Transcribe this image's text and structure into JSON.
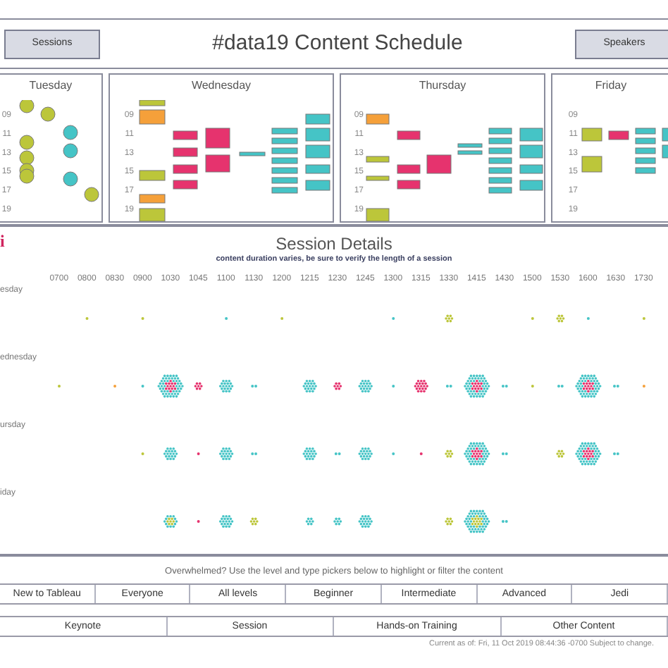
{
  "header": {
    "left_button": "Sessions",
    "title": "#data19 Content Schedule",
    "right_button": "Speakers"
  },
  "day_panels": [
    {
      "title": "Tuesday",
      "ticks": [
        "09",
        "11",
        "13",
        "15",
        "17",
        "19"
      ]
    },
    {
      "title": "Wednesday",
      "ticks": [
        "09",
        "11",
        "13",
        "15",
        "17",
        "19"
      ]
    },
    {
      "title": "Thursday",
      "ticks": [
        "09",
        "11",
        "13",
        "15",
        "17",
        "19"
      ]
    },
    {
      "title": "Friday",
      "ticks": [
        "09",
        "11",
        "13",
        "15",
        "17",
        "19"
      ]
    }
  ],
  "session_details": {
    "info_icon": "i",
    "title": "Session Details",
    "subtitle": "content duration varies, be sure to verify the length of a session",
    "time_ticks": [
      "0700",
      "0800",
      "0830",
      "0900",
      "1030",
      "1045",
      "1100",
      "1130",
      "1200",
      "1215",
      "1230",
      "1245",
      "1300",
      "1315",
      "1330",
      "1415",
      "1430",
      "1500",
      "1530",
      "1600",
      "1630",
      "1730"
    ],
    "rows": [
      {
        "label": "esday"
      },
      {
        "label": "ednesday"
      },
      {
        "label": "ursday"
      },
      {
        "label": "iday"
      }
    ]
  },
  "note": "Overwhelmed? Use the level and type pickers below to highlight or filter the content",
  "level_picker": [
    {
      "label": "New to Tableau",
      "selected": false
    },
    {
      "label": "Everyone",
      "selected": false
    },
    {
      "label": "All levels",
      "selected": false
    },
    {
      "label": "Beginner",
      "selected": false
    },
    {
      "label": "Intermediate",
      "selected": false
    },
    {
      "label": "Advanced",
      "selected": false
    },
    {
      "label": "Jedi",
      "selected": false
    }
  ],
  "type_picker": [
    {
      "label": "Keynote",
      "selected": false
    },
    {
      "label": "Session",
      "selected": false
    },
    {
      "label": "Hands-on Training",
      "selected": false
    },
    {
      "label": "Other Content",
      "selected": false
    }
  ],
  "footer": "Current as of: Fri, 11 Oct 2019 08:44:36 -0700 Subject to change."
}
